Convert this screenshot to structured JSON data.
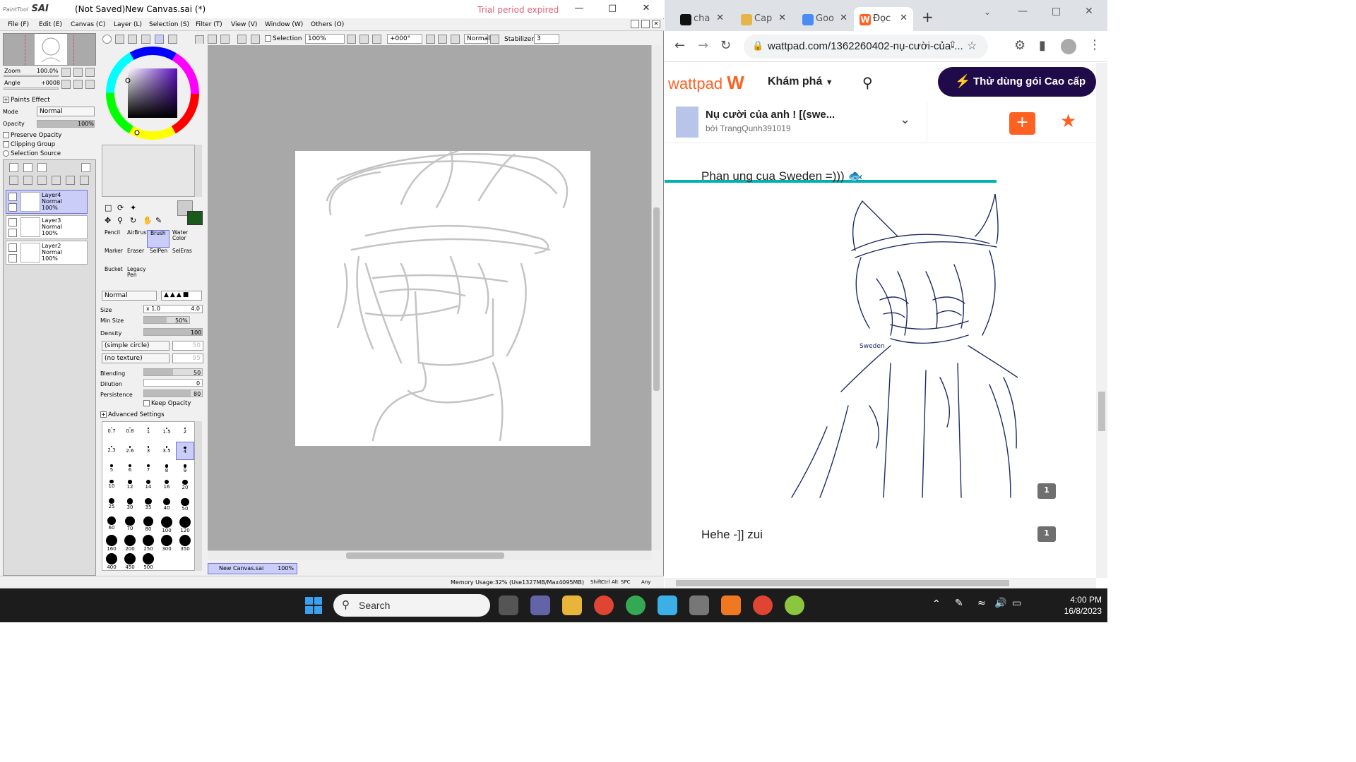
{
  "sai": {
    "logo_small": "PaintTool",
    "logo": "SAI",
    "title": "(Not Saved)New Canvas.sai (*)",
    "trial": "Trial period expired",
    "menu": [
      "File (F)",
      "Edit (E)",
      "Canvas (C)",
      "Layer (L)",
      "Selection (S)",
      "Filter (T)",
      "View (V)",
      "Window (W)",
      "Others (O)"
    ],
    "toolbar": {
      "selection_label": "Selection",
      "zoom": "100%",
      "rotation": "+000°",
      "blend": "Normal",
      "stabilizer_label": "Stabilizer",
      "stabilizer_value": "3"
    },
    "nav": {
      "zoom_label": "Zoom",
      "zoom_value": "100.0%",
      "angle_label": "Angle",
      "angle_value": "+0008"
    },
    "paints_effect": "Paints Effect",
    "mode_label": "Mode",
    "mode_value": "Normal",
    "opacity_label": "Opacity",
    "opacity_value": "100%",
    "opacity_level": 1.0,
    "preserve_opacity": "Preserve Opacity",
    "clipping_group": "Clipping Group",
    "selection_source": "Selection Source",
    "layers": [
      {
        "name": "Layer4",
        "mode": "Normal",
        "opacity": "100%",
        "selected": true
      },
      {
        "name": "Layer3",
        "mode": "Normal",
        "opacity": "100%",
        "selected": false
      },
      {
        "name": "Layer2",
        "mode": "Normal",
        "opacity": "100%",
        "selected": false
      }
    ],
    "tools": [
      "Pencil",
      "AirBrush",
      "Brush",
      "Water Color",
      "Marker",
      "Eraser",
      "SelPen",
      "SelEras",
      "Bucket",
      "Legacy Pen"
    ],
    "brush_mode": "Normal",
    "size_label": "Size",
    "size_mult": "x 1.0",
    "size_value": "4.0",
    "min_size_label": "Min Size",
    "min_size_value": "50%",
    "min_size_level": 0.5,
    "density_label": "Density",
    "density_value": "100",
    "density_level": 1.0,
    "shape": "(simple circle)",
    "shape_value": "50",
    "texture": "(no texture)",
    "texture_value": "95",
    "blending_label": "Blending",
    "blending_value": "50",
    "blending_level": 0.5,
    "dilution_label": "Dilution",
    "dilution_value": "0",
    "dilution_level": 0,
    "persistence_label": "Persistence",
    "persistence_value": "80",
    "persistence_level": 0.8,
    "keep_opacity": "Keep Opacity",
    "advanced_settings": "Advanced Settings",
    "brush_sizes": [
      "0.7",
      "0.8",
      "1",
      "1.5",
      "2",
      "2.3",
      "2.6",
      "3",
      "3.5",
      "4",
      "5",
      "6",
      "7",
      "8",
      "9",
      "10",
      "12",
      "14",
      "16",
      "20",
      "25",
      "30",
      "35",
      "40",
      "50",
      "60",
      "70",
      "80",
      "100",
      "120",
      "160",
      "200",
      "250",
      "300",
      "350",
      "400",
      "450",
      "500"
    ],
    "doc_tab": "New Canvas.sai",
    "doc_zoom": "100%",
    "memory": "Memory Usage:32% (Use1327MB/Max4095MB)",
    "modifier_keys": [
      "Shift",
      "Ctrl",
      "Alt",
      "SPC",
      "Any"
    ]
  },
  "chrome": {
    "tabs": [
      {
        "label": "cha",
        "active": false
      },
      {
        "label": "Cap",
        "active": false
      },
      {
        "label": "Goo",
        "active": false
      },
      {
        "label": "Đọc",
        "active": true
      }
    ],
    "url": "wattpad.com/1362260402-nụ-cười-của-...",
    "page": {
      "logo": "wattpad",
      "explore": "Khám phá",
      "premium": "Thử dùng gói Cao cấp",
      "story_title": "Nụ cười của anh ! [(swe...",
      "story_author": "bởi TrangQunh391019",
      "add_label": "+",
      "reading_progress": 0.77,
      "paragraph1": "Phan ung cua Sweden =)))",
      "paragraph2": "Hehe -]] zui",
      "comment_count_1": "1",
      "comment_count_2": "1",
      "sketch_signature": "Sweden"
    }
  },
  "taskbar": {
    "search": "Search",
    "time": "4:00 PM",
    "date": "16/8/2023"
  },
  "colors": {
    "sai_selected": "#c9cdf8",
    "wattpad_orange": "#ff6122",
    "premium_bg": "#1f0a4a",
    "progress": "#00b2b2",
    "trial_text": "#e0607a"
  }
}
